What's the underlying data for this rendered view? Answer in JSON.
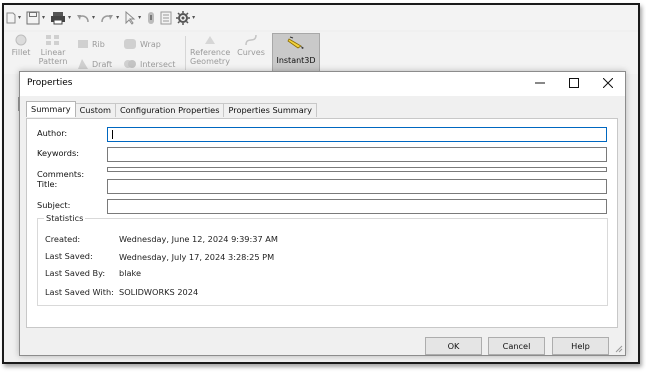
{
  "toolbar": {
    "icons": [
      "new-file-icon",
      "save-icon",
      "print-icon",
      "undo-icon",
      "redo-icon",
      "select-icon",
      "rebuild-icon",
      "file-properties-icon",
      "options-icon"
    ]
  },
  "ribbon": {
    "fillet": "Fillet",
    "linear_pattern_1": "Linear",
    "linear_pattern_2": "Pattern",
    "rib": "Rib",
    "draft": "Draft",
    "wrap": "Wrap",
    "intersect": "Intersect",
    "reference_1": "Reference",
    "reference_2": "Geometry",
    "curves": "Curves",
    "instant3d": "Instant3D"
  },
  "dialog": {
    "title": "Properties",
    "tabs": [
      "Summary",
      "Custom",
      "Configuration Properties",
      "Properties Summary"
    ],
    "fields": {
      "author_label": "Author:",
      "author_value": "",
      "keywords_label": "Keywords:",
      "keywords_value": "",
      "comments_label": "Comments:",
      "comments_value": "",
      "title_label": "Title:",
      "title_value": "",
      "subject_label": "Subject:",
      "subject_value": ""
    },
    "statistics": {
      "legend": "Statistics",
      "rows": [
        {
          "label": "Created:",
          "value": "Wednesday, June 12, 2024 9:39:37 AM"
        },
        {
          "label": "Last Saved:",
          "value": "Wednesday, July 17, 2024 3:28:25 PM"
        },
        {
          "label": "Last Saved By:",
          "value": "blake"
        },
        {
          "label": "Last Saved With:",
          "value": "SOLIDWORKS 2024"
        }
      ]
    },
    "buttons": {
      "ok": "OK",
      "cancel": "Cancel",
      "help": "Help"
    }
  },
  "colors": {
    "accent": "#0067c0",
    "instant3d_bg": "#c9c9c9"
  }
}
